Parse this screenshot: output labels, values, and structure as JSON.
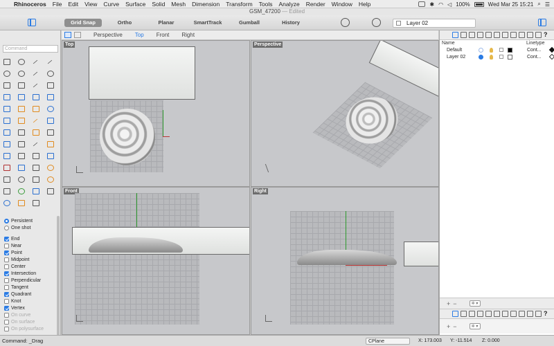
{
  "menubar": {
    "app_name": "Rhinoceros",
    "menus": [
      "File",
      "Edit",
      "View",
      "Curve",
      "Surface",
      "Solid",
      "Mesh",
      "Dimension",
      "Transform",
      "Tools",
      "Analyze",
      "Render",
      "Window",
      "Help"
    ],
    "battery": "100%",
    "clock": "Wed Mar 25  15:21"
  },
  "window": {
    "title": "GSM_47200",
    "status": "— Edited"
  },
  "toolbar": {
    "modes": [
      {
        "label": "Grid Snap",
        "active": true
      },
      {
        "label": "Ortho",
        "active": false
      },
      {
        "label": "Planar",
        "active": false
      },
      {
        "label": "SmartTrack",
        "active": false
      },
      {
        "label": "Gumball",
        "active": false
      },
      {
        "label": "History",
        "active": false
      }
    ],
    "current_layer": "Layer 02"
  },
  "command": {
    "placeholder": "Command"
  },
  "viewport_tabs": [
    "Perspective",
    "Top",
    "Front",
    "Right"
  ],
  "active_viewport_tab": "Top",
  "viewports": {
    "top": "Top",
    "perspective": "Perspective",
    "front": "Front",
    "right": "Right"
  },
  "osnap": {
    "mode": [
      {
        "label": "Persistent",
        "selected": true
      },
      {
        "label": "One shot",
        "selected": false
      }
    ],
    "snaps": [
      {
        "label": "End",
        "checked": true,
        "enabled": true
      },
      {
        "label": "Near",
        "checked": false,
        "enabled": true
      },
      {
        "label": "Point",
        "checked": true,
        "enabled": true
      },
      {
        "label": "Midpoint",
        "checked": false,
        "enabled": true
      },
      {
        "label": "Center",
        "checked": false,
        "enabled": true
      },
      {
        "label": "Intersection",
        "checked": true,
        "enabled": true
      },
      {
        "label": "Perpendicular",
        "checked": false,
        "enabled": true
      },
      {
        "label": "Tangent",
        "checked": false,
        "enabled": true
      },
      {
        "label": "Quadrant",
        "checked": true,
        "enabled": true
      },
      {
        "label": "Knot",
        "checked": false,
        "enabled": true
      },
      {
        "label": "Vertex",
        "checked": true,
        "enabled": true
      },
      {
        "label": "On curve",
        "checked": false,
        "enabled": false
      },
      {
        "label": "On surface",
        "checked": false,
        "enabled": false
      },
      {
        "label": "On polysurface",
        "checked": false,
        "enabled": false
      }
    ]
  },
  "layers": {
    "headers": {
      "name": "Name",
      "linetype": "Linetype"
    },
    "rows": [
      {
        "name": "Default",
        "current": false,
        "color": "#000000",
        "linetype": "Cont..."
      },
      {
        "name": "Layer 02",
        "current": true,
        "color": "#ffffff",
        "linetype": "Cont..."
      }
    ]
  },
  "statusbar": {
    "command": "Command: _Drag",
    "cplane": "CPlane",
    "x": "X: 173.003",
    "y": "Y: -11.514",
    "z": "Z: 0.000"
  },
  "colors": {
    "accent": "#2a7be4",
    "viewport_bg": "#c7c8cb"
  }
}
